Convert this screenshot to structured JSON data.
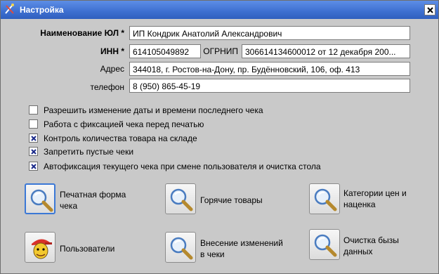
{
  "window": {
    "title": "Настройка"
  },
  "form": {
    "name_label": "Наименование ЮЛ *",
    "name_value": "ИП Кондрик Анатолий Александрович",
    "inn_label": "ИНН *",
    "inn_value": "614105049892",
    "ogrnip_label": "ОГРНИП",
    "ogrnip_value": "306614134600012 от 12 декабря 200...",
    "address_label": "Адрес",
    "address_value": "344018, г. Ростов-на-Дону, пр. Будённовский, 106, оф. 413",
    "phone_label": "телефон",
    "phone_value": "8 (950) 865-45-19"
  },
  "options": [
    {
      "label": "Разрешить изменение даты и времени последнего  чека",
      "checked": false
    },
    {
      "label": "Работа с фиксацией чека перед печатью",
      "checked": false
    },
    {
      "label": "Контроль количества товара на складе",
      "checked": true
    },
    {
      "label": "Запретить пустые чеки",
      "checked": true
    },
    {
      "label": "Автофиксация текущего чека при смене пользователя и очистка стола",
      "checked": true
    }
  ],
  "tiles": {
    "print_form": {
      "line1": "Печатная форма",
      "line2": "чека"
    },
    "hot_goods": {
      "line1": "Горячие товары"
    },
    "price_categories": {
      "line1": "Категории цен и",
      "line2": "наценка"
    },
    "users": {
      "line1": "Пользователи"
    },
    "receipt_changes": {
      "line1": "Внесение изменений",
      "line2": "в чеки"
    },
    "clear_db": {
      "line1": "Очистка бызы",
      "line2": "данных"
    }
  },
  "icons": {
    "title": "settings-tools-icon",
    "close": "close-icon",
    "tile_search": "magnifier-icon",
    "users": "user-avatar-icon"
  },
  "colors": {
    "titlebar": "#3d6fd0",
    "window_bg": "#c9c9c9",
    "focus_border": "#3b78d6",
    "checkmark": "#1a2a8a"
  }
}
